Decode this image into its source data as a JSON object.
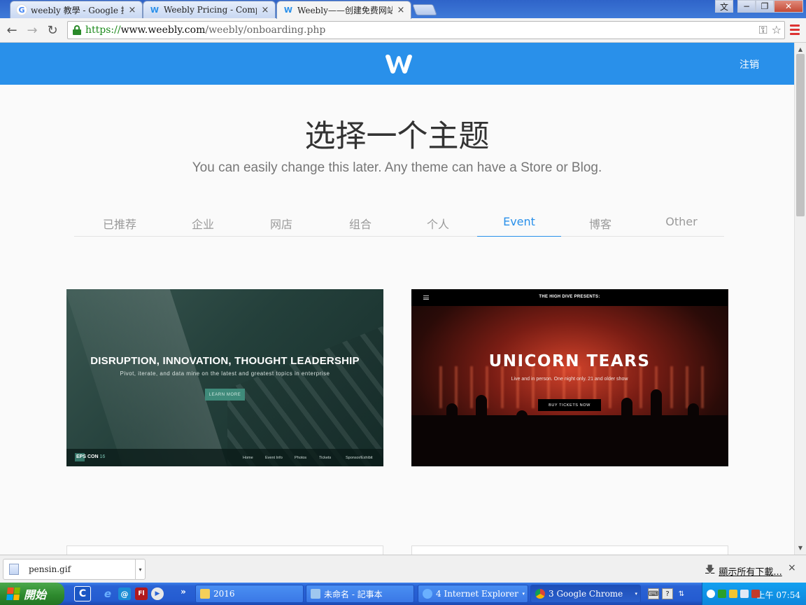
{
  "browser": {
    "tabs": [
      {
        "title": "weebly 教學 - Google 搜尋",
        "icon": "google-icon"
      },
      {
        "title": "Weebly Pricing - Compare W",
        "icon": "weebly-icon"
      },
      {
        "title": "Weebly——创建免费网站",
        "icon": "weebly-icon"
      }
    ],
    "tab_close": "×",
    "ime_label": "文",
    "window_controls": {
      "minimize": "−",
      "restore": "❐",
      "close": "✕"
    },
    "nav": {
      "back": "←",
      "forward": "→",
      "reload": "↻"
    },
    "url": {
      "scheme": "https://",
      "host": "www.weebly.com",
      "path": "/weebly/onboarding.php"
    },
    "key_icon": "⚿",
    "star_icon": "☆"
  },
  "site": {
    "logout": "注销",
    "title": "选择一个主题",
    "subtitle": "You can easily change this later. Any theme can have a Store or Blog.",
    "categories": [
      "已推荐",
      "企业",
      "网店",
      "组合",
      "个人",
      "Event",
      "博客",
      "Other"
    ],
    "active_category": "Event",
    "brand_color": "#2990ea",
    "themes": [
      {
        "headline": "DISRUPTION, INNOVATION, THOUGHT LEADERSHIP",
        "sub": "Pivot, iterate, and data mine on the latest and greatest topics in enterprise",
        "cta": "LEARN MORE",
        "brand": "EPS CON",
        "brand_num": "16",
        "nav": [
          "Home",
          "Event Info",
          "Photos",
          "Tickets",
          "Sponsor/Exhibit"
        ]
      },
      {
        "presents": "THE HIGH DIVE PRESENTS:",
        "headline": "UNICORN TEARS",
        "sub": "Live and in person. One night only. 21 and older show",
        "cta": "BUY TICKETS NOW"
      }
    ]
  },
  "scrollbar": {
    "up": "▲",
    "down": "▼"
  },
  "downloads": {
    "file": "pensin.gif",
    "caret": "▾",
    "show_all": "顯示所有下載...",
    "show_all_icon": "🡇",
    "close": "×"
  },
  "taskbar": {
    "start": "開始",
    "quick_launch_more": "»",
    "tasks": [
      {
        "label": "2016"
      },
      {
        "label": "未命名 - 記事本"
      },
      {
        "label": "4 Internet Explorer"
      },
      {
        "label": "3 Google Chrome"
      }
    ],
    "task_caret": "▾",
    "clock": "上午 07:54"
  }
}
